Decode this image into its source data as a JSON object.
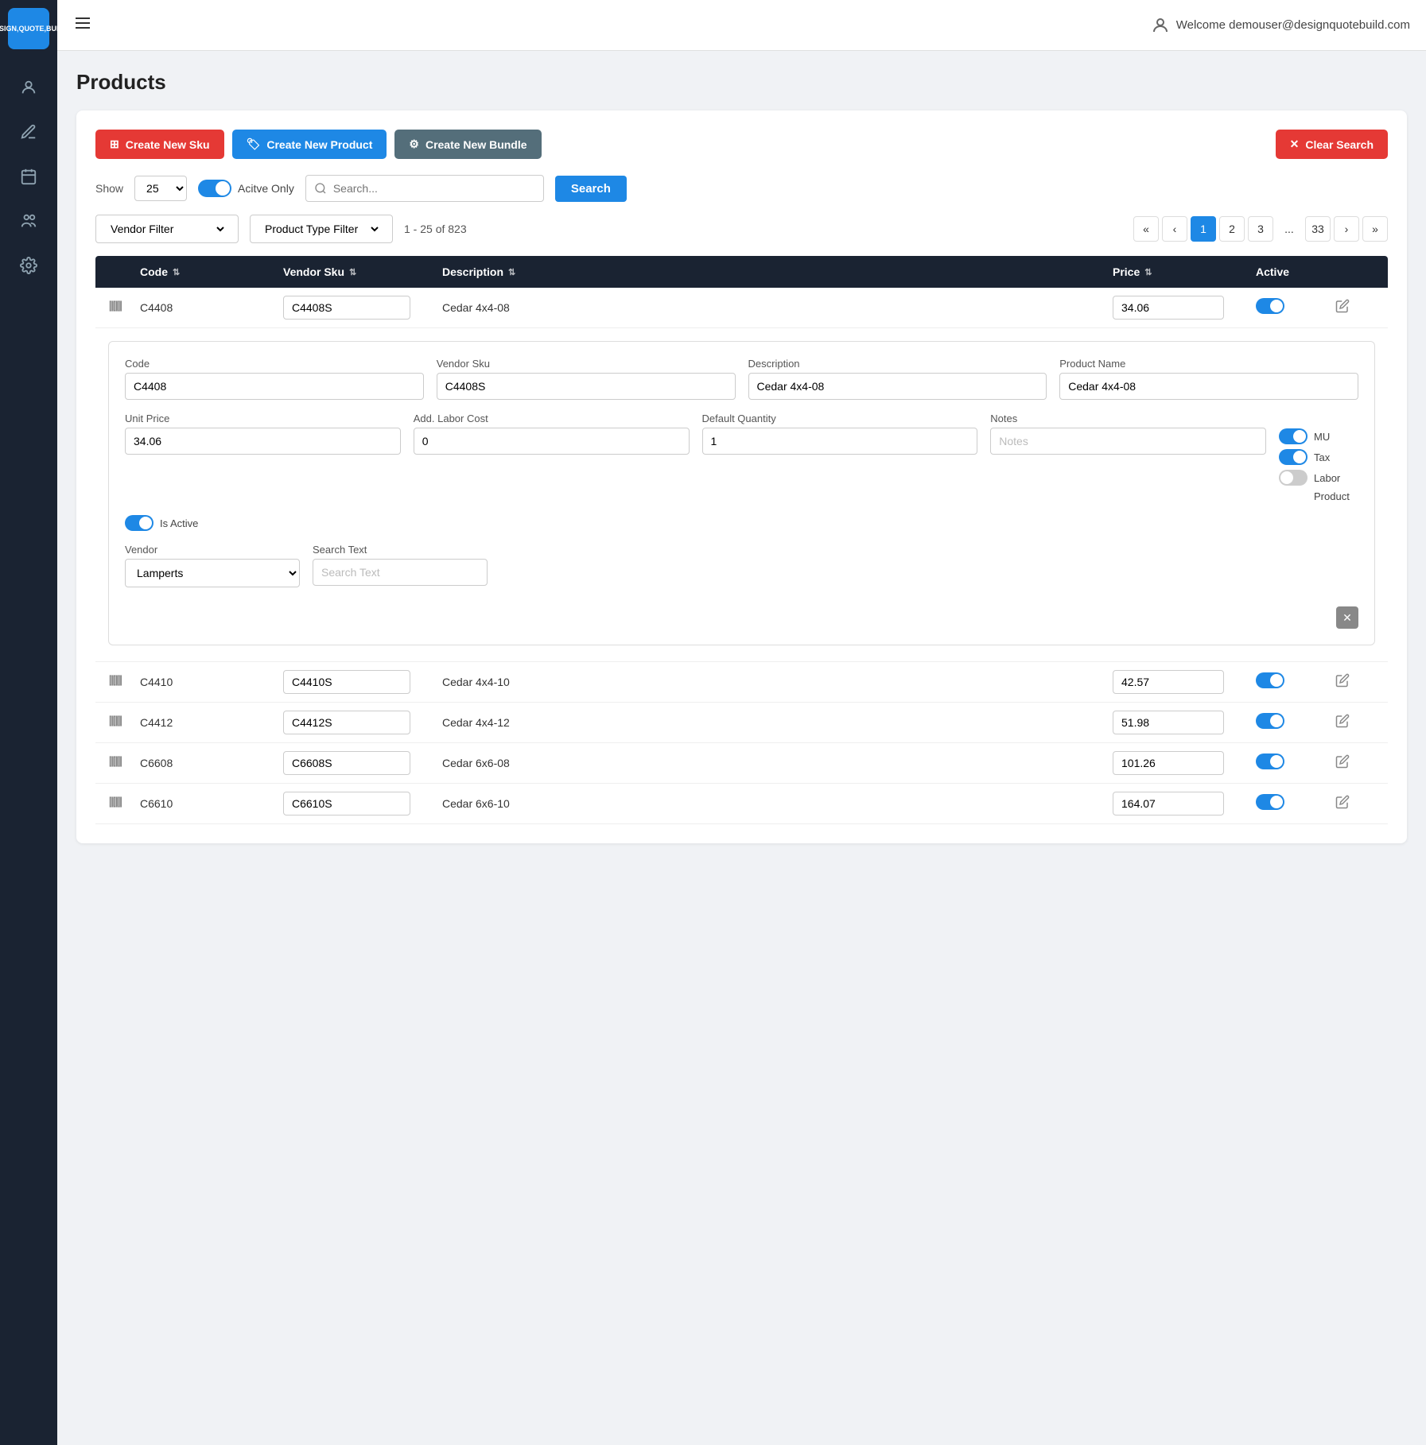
{
  "app": {
    "logo_lines": [
      "DESIGN",
      "QUOTE",
      "BUILD"
    ],
    "user_welcome": "Welcome demouser@designquotebuild.com"
  },
  "sidebar": {
    "items": [
      {
        "name": "user-icon",
        "label": "User"
      },
      {
        "name": "pencil-icon",
        "label": "Edit"
      },
      {
        "name": "calendar-icon",
        "label": "Calendar"
      },
      {
        "name": "team-icon",
        "label": "Team"
      },
      {
        "name": "settings-icon",
        "label": "Settings"
      }
    ]
  },
  "page": {
    "title": "Products"
  },
  "toolbar": {
    "create_sku_label": "Create New Sku",
    "create_product_label": "Create New Product",
    "create_bundle_label": "Create New Bundle",
    "clear_search_label": "Clear Search"
  },
  "controls": {
    "show_label": "Show",
    "show_value": "25",
    "active_only_label": "Acitve Only",
    "active_only_on": true,
    "search_placeholder": "Search...",
    "search_button_label": "Search"
  },
  "filters": {
    "vendor_filter_label": "Vendor Filter",
    "product_type_filter_label": "Product Type Filter",
    "pagination_info": "1 - 25 of 823",
    "pages": [
      "«",
      "‹",
      "1",
      "2",
      "3",
      "...",
      "33",
      "›",
      "»"
    ],
    "active_page": "1"
  },
  "table": {
    "headers": [
      {
        "label": "Code",
        "sortable": true
      },
      {
        "label": "Vendor Sku",
        "sortable": true
      },
      {
        "label": "Description",
        "sortable": true
      },
      {
        "label": "Price",
        "sortable": true
      },
      {
        "label": "Active",
        "sortable": false
      }
    ],
    "rows": [
      {
        "code": "C4408",
        "vendor_sku": "C4408S",
        "description": "Cedar 4x4-08",
        "price": "34.06",
        "active": true,
        "expanded": true,
        "form": {
          "code": "C4408",
          "vendor_sku": "C4408S",
          "description": "Cedar 4x4-08",
          "product_name": "Cedar 4x4-08",
          "unit_price": "34.06",
          "add_labor_cost": "0",
          "default_quantity": "1",
          "notes_placeholder": "Notes",
          "mu": true,
          "tax": true,
          "labor": false,
          "is_active": true,
          "vendor": "Lamperts",
          "search_text": "",
          "search_text_placeholder": "Search Text",
          "labels": {
            "code": "Code",
            "vendor_sku": "Vendor Sku",
            "description": "Description",
            "product_name": "Product Name",
            "unit_price": "Unit Price",
            "add_labor_cost": "Add. Labor Cost",
            "default_quantity": "Default Quantity",
            "notes": "Notes",
            "mu": "MU",
            "tax": "Tax",
            "labor": "Labor",
            "product": "Product",
            "is_active": "Is Active",
            "vendor": "Vendor",
            "search_text": "Search Text"
          }
        }
      },
      {
        "code": "C4410",
        "vendor_sku": "C4410S",
        "description": "Cedar 4x4-10",
        "price": "42.57",
        "active": true,
        "expanded": false
      },
      {
        "code": "C4412",
        "vendor_sku": "C4412S",
        "description": "Cedar 4x4-12",
        "price": "51.98",
        "active": true,
        "expanded": false
      },
      {
        "code": "C6608",
        "vendor_sku": "C6608S",
        "description": "Cedar 6x6-08",
        "price": "101.26",
        "active": true,
        "expanded": false
      },
      {
        "code": "C6610",
        "vendor_sku": "C6610S",
        "description": "Cedar 6x6-10",
        "price": "164.07",
        "active": true,
        "expanded": false
      }
    ]
  }
}
